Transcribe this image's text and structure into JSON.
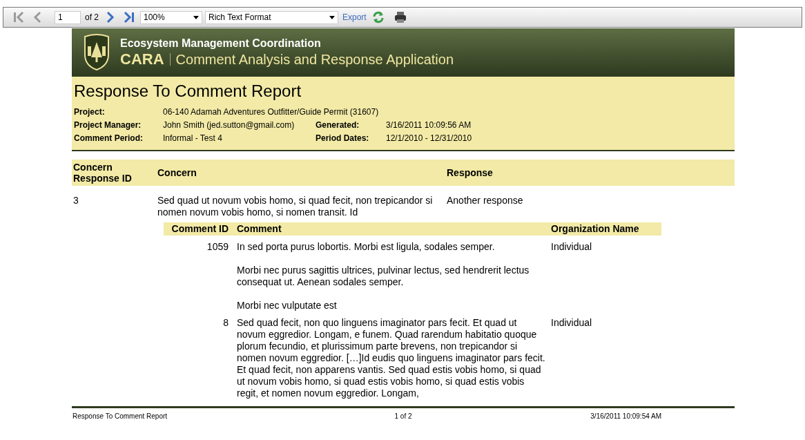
{
  "toolbar": {
    "nav": [
      {
        "kind": "first",
        "disabled": true
      },
      {
        "kind": "prev",
        "disabled": true
      }
    ],
    "page_value": "1",
    "page_of": "of 2",
    "nav_after": [
      {
        "kind": "next",
        "disabled": false
      },
      {
        "kind": "last",
        "disabled": false
      }
    ],
    "zoom": "100%",
    "format": "Rich Text Format",
    "export": "Export"
  },
  "header": {
    "org": "Ecosystem Management Coordination",
    "app_short": "CARA",
    "app_name": "Comment Analysis and Response Application"
  },
  "report": {
    "title": "Response To Comment Report",
    "fields": [
      {
        "label": "Project:",
        "value": "06-140 Adamah Adventures Outfitter/Guide Permit (31607)"
      },
      {
        "label": "Project Manager:",
        "value": "John Smith (jed.sutton@gmail.com)",
        "label2": "Generated:",
        "value2": "3/16/2011 10:09:56 AM"
      },
      {
        "label": "Comment Period:",
        "value": "Informal - Test 4",
        "label2": "Period Dates:",
        "value2": "12/1/2010 - 12/31/2010"
      }
    ]
  },
  "table": {
    "columns": [
      "Concern Response ID",
      "Concern",
      "Response"
    ],
    "rows": [
      {
        "id": "3",
        "concern": "Sed quad ut novum vobis homo, si quad fecit, non trepicandor si nomen novum vobis homo, si nomen transit. Id",
        "response": "Another response",
        "comments": {
          "columns": [
            "Comment ID",
            "Comment",
            "Organization Name"
          ],
          "rows": [
            {
              "id": "1059",
              "paragraphs": [
                "In sed porta purus lobortis. Morbi est ligula, sodales semper.",
                "Morbi nec purus sagittis ultrices, pulvinar lectus, sed hendrerit lectus consequat ut. Aenean sodales semper.",
                "Morbi nec vulputate est"
              ],
              "org": "Individual"
            },
            {
              "id": "8",
              "paragraphs": [
                "Sed quad fecit, non quo linguens imaginator pars fecit. Et quad ut novum eggredior. Longam, e funem. Quad rarendum habitatio quoque plorum fecundio, et plurissimum parte brevens, non trepicandor si nomen novum eggredior. […]Id eudis quo linguens imaginator pars fecit. Et quad fecit, non apparens vantis. Sed quad estis vobis homo, si quad ut novum vobis homo, si quad estis vobis homo, si quad estis vobis regit, et nomen novum eggredior. Longam,"
              ],
              "org": "Individual"
            }
          ]
        }
      }
    ]
  },
  "footer": {
    "left": "Response To Comment Report",
    "center": "1 of 2",
    "right": "3/16/2011 10:09:54 AM"
  }
}
